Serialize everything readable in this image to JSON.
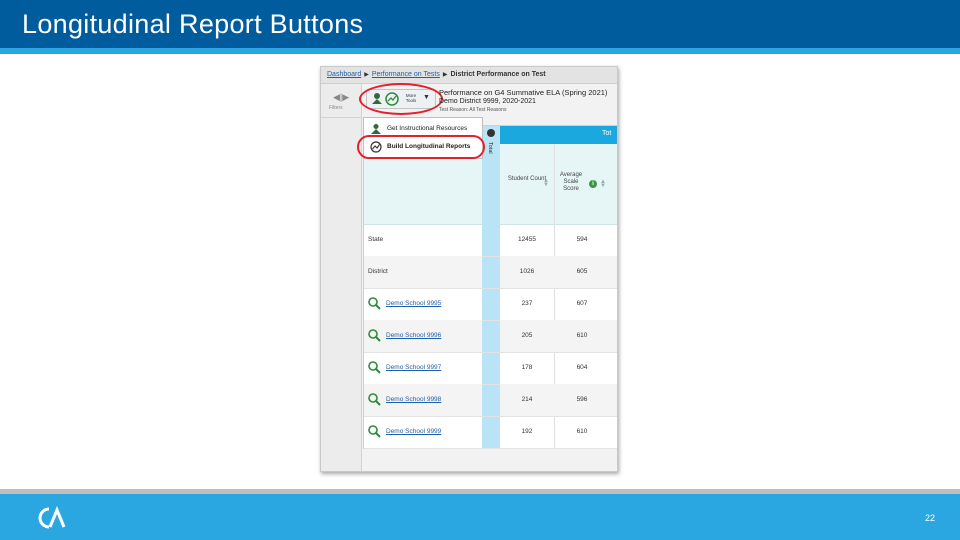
{
  "slide": {
    "title": "Longitudinal Report Buttons",
    "page_number": "22",
    "colors": {
      "title_bar": "#005c9c",
      "accent": "#2aa7e0",
      "highlight": "#e3202c"
    }
  },
  "screenshot": {
    "breadcrumbs": [
      {
        "label": "Dashboard",
        "link": true
      },
      {
        "label": "Performance on Tests",
        "link": true
      },
      {
        "label": "District Performance on Test",
        "link": false
      }
    ],
    "filters_label": "Filters",
    "toolbar": {
      "more_tools_line1": "More",
      "more_tools_line2": "Tools"
    },
    "report": {
      "title": "Performance on G4 Summative ELA (Spring 2021)",
      "subtitle": "Demo District 9999, 2020-2021",
      "test_reason": "Test Reason: All Test Reasons"
    },
    "menu": {
      "items": [
        {
          "label": "Get Instructional Resources",
          "icon": "resources-icon"
        },
        {
          "label": "Build Longitudinal Reports",
          "icon": "longitudinal-icon"
        }
      ]
    },
    "table": {
      "collapse_label": "Total",
      "total_label": "Tot",
      "columns": [
        "Student Count",
        "Average Scale Score"
      ],
      "rows": [
        {
          "name": "State",
          "count": "12455",
          "avg": "594",
          "link": false
        },
        {
          "name": "District",
          "count": "1026",
          "avg": "605",
          "link": false
        },
        {
          "name": "Demo School 9995",
          "count": "237",
          "avg": "607",
          "link": true
        },
        {
          "name": "Demo School 9996",
          "count": "205",
          "avg": "610",
          "link": true
        },
        {
          "name": "Demo School 9997",
          "count": "178",
          "avg": "604",
          "link": true
        },
        {
          "name": "Demo School 9998",
          "count": "214",
          "avg": "596",
          "link": true
        },
        {
          "name": "Demo School 9999",
          "count": "192",
          "avg": "610",
          "link": true
        }
      ]
    }
  }
}
